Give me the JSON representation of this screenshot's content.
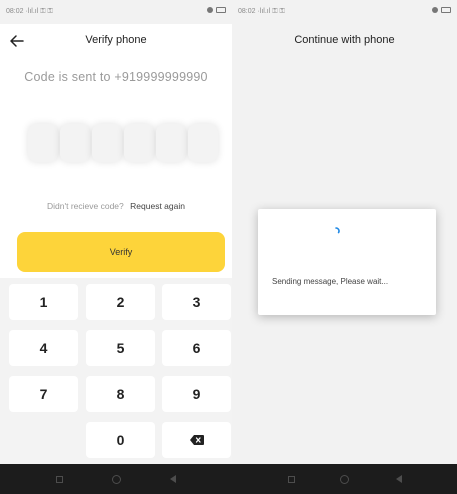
{
  "left_screen": {
    "status_bar": {
      "text": "08:02 ·lıl.ıl ⚿ ⚿"
    },
    "app_bar": {
      "title": "Verify phone",
      "back_icon": "arrow-left-icon"
    },
    "code_sent_text": "Code is sent to +919999999990",
    "otp_boxes": [
      "",
      "",
      "",
      "",
      "",
      ""
    ],
    "resend": {
      "question": "Didn't recieve code?",
      "link": "Request again"
    },
    "verify_button": {
      "label": "Verify",
      "color": "#fdd43a"
    },
    "keypad": {
      "keys": [
        "1",
        "2",
        "3",
        "4",
        "5",
        "6",
        "7",
        "8",
        "9",
        "",
        "0",
        "⌫"
      ],
      "delete_icon": "backspace-icon"
    }
  },
  "right_screen": {
    "status_bar": {
      "text": "08:02 ·lıl.ıl ⚿ ⚿"
    },
    "app_bar": {
      "title": "Continue with phone"
    },
    "dialog": {
      "message": "Sending message, Please wait...",
      "icon": "spinner-icon",
      "accent": "#1e88e5"
    }
  }
}
